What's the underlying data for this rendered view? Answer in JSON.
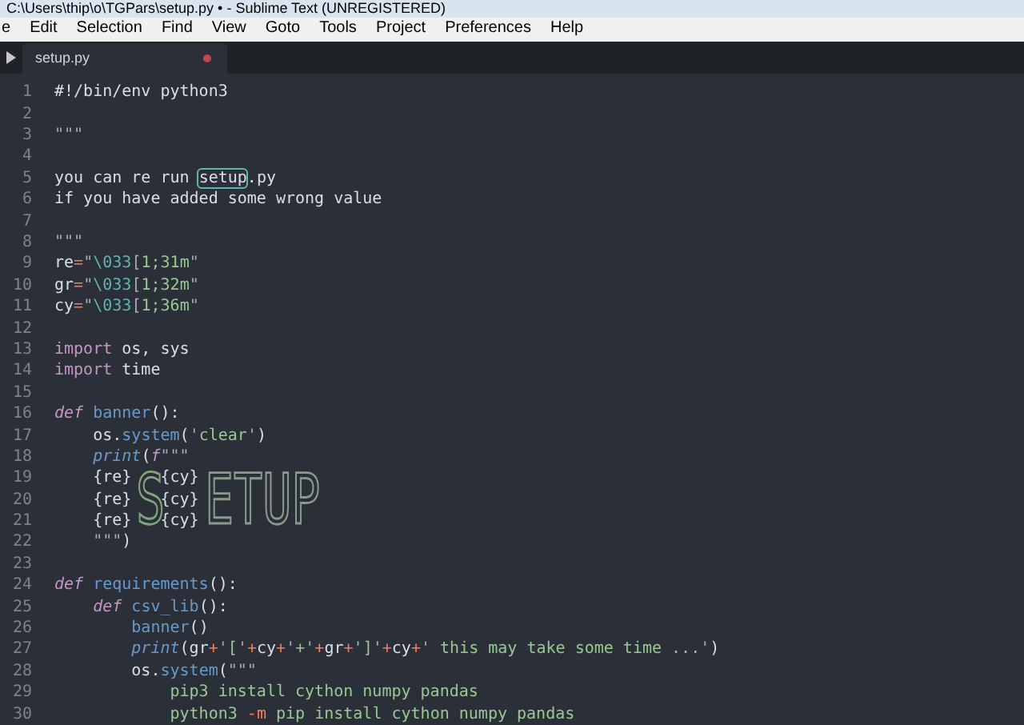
{
  "window": {
    "title": "C:\\Users\\thip\\o\\TGPars\\setup.py • - Sublime Text (UNREGISTERED)"
  },
  "menu": [
    "e",
    "Edit",
    "Selection",
    "Find",
    "View",
    "Goto",
    "Tools",
    "Project",
    "Preferences",
    "Help"
  ],
  "tabs": [
    {
      "label": "setup.py",
      "selected": true,
      "modified": true
    }
  ],
  "ascii_art": [
    "S",
    "ETUP"
  ],
  "lines": [
    {
      "n": "1",
      "tokens": [
        {
          "kind": "p",
          "text": "#!/bin/env python3"
        }
      ]
    },
    {
      "n": "2"
    },
    {
      "n": "3",
      "tokens": [
        {
          "kind": "q",
          "text": "\"\"\""
        }
      ]
    },
    {
      "n": "4"
    },
    {
      "n": "5",
      "tokens": [
        {
          "kind": "p",
          "text": "you can re run "
        },
        {
          "kind": "hl",
          "text": "setup"
        },
        {
          "kind": "p",
          "text": ".py"
        }
      ]
    },
    {
      "n": "6",
      "tokens": [
        {
          "kind": "p",
          "text": "if you have added some wrong value"
        }
      ]
    },
    {
      "n": "7"
    },
    {
      "n": "8",
      "tokens": [
        {
          "kind": "q",
          "text": "\"\"\""
        }
      ]
    },
    {
      "n": "9",
      "tokens": [
        {
          "kind": "p",
          "text": "re"
        },
        {
          "kind": "o",
          "text": "="
        },
        {
          "kind": "q",
          "text": "\""
        },
        {
          "kind": "e",
          "text": "\\033"
        },
        {
          "kind": "q",
          "text": "["
        },
        {
          "kind": "s",
          "text": "1;31m"
        },
        {
          "kind": "q",
          "text": "\""
        }
      ]
    },
    {
      "n": "10",
      "tokens": [
        {
          "kind": "p",
          "text": "gr"
        },
        {
          "kind": "o",
          "text": "="
        },
        {
          "kind": "q",
          "text": "\""
        },
        {
          "kind": "e",
          "text": "\\033"
        },
        {
          "kind": "q",
          "text": "["
        },
        {
          "kind": "s",
          "text": "1;32m"
        },
        {
          "kind": "q",
          "text": "\""
        }
      ]
    },
    {
      "n": "11",
      "tokens": [
        {
          "kind": "p",
          "text": "cy"
        },
        {
          "kind": "o",
          "text": "="
        },
        {
          "kind": "q",
          "text": "\""
        },
        {
          "kind": "e",
          "text": "\\033"
        },
        {
          "kind": "q",
          "text": "["
        },
        {
          "kind": "s",
          "text": "1;36m"
        },
        {
          "kind": "q",
          "text": "\""
        }
      ]
    },
    {
      "n": "12"
    },
    {
      "n": "13",
      "tokens": [
        {
          "kind": "k",
          "text": "import"
        },
        {
          "kind": "p",
          "text": " os, sys"
        }
      ]
    },
    {
      "n": "14",
      "tokens": [
        {
          "kind": "k",
          "text": "import"
        },
        {
          "kind": "p",
          "text": " time"
        }
      ]
    },
    {
      "n": "15"
    },
    {
      "n": "16",
      "tokens": [
        {
          "kind": "d",
          "text": "def"
        },
        {
          "kind": "f",
          "text": " banner"
        },
        {
          "kind": "p",
          "text": "():"
        }
      ]
    },
    {
      "n": "17",
      "tokens": [
        {
          "kind": "p",
          "text": "    os."
        },
        {
          "kind": "f",
          "text": "system"
        },
        {
          "kind": "p",
          "text": "("
        },
        {
          "kind": "q",
          "text": "'"
        },
        {
          "kind": "s",
          "text": "clear"
        },
        {
          "kind": "q",
          "text": "'"
        },
        {
          "kind": "p",
          "text": ")"
        }
      ]
    },
    {
      "n": "18",
      "tokens": [
        {
          "kind": "b",
          "text": "    print"
        },
        {
          "kind": "p",
          "text": "("
        },
        {
          "kind": "d",
          "text": "f"
        },
        {
          "kind": "q",
          "text": "\"\"\""
        }
      ]
    },
    {
      "n": "19",
      "tokens": [
        {
          "kind": "p",
          "text": "    {re}   {cy}"
        }
      ]
    },
    {
      "n": "20",
      "tokens": [
        {
          "kind": "p",
          "text": "    {re}   {cy}"
        }
      ]
    },
    {
      "n": "21",
      "tokens": [
        {
          "kind": "p",
          "text": "    {re}   {cy}"
        }
      ]
    },
    {
      "n": "22",
      "tokens": [
        {
          "kind": "q",
          "text": "    \"\"\""
        },
        {
          "kind": "p",
          "text": ")"
        }
      ]
    },
    {
      "n": "23"
    },
    {
      "n": "24",
      "tokens": [
        {
          "kind": "d",
          "text": "def"
        },
        {
          "kind": "f",
          "text": " requirements"
        },
        {
          "kind": "p",
          "text": "():"
        }
      ]
    },
    {
      "n": "25",
      "tokens": [
        {
          "kind": "d",
          "text": "    def"
        },
        {
          "kind": "f",
          "text": " csv_lib"
        },
        {
          "kind": "p",
          "text": "():"
        }
      ]
    },
    {
      "n": "26",
      "tokens": [
        {
          "kind": "f",
          "text": "        banner"
        },
        {
          "kind": "p",
          "text": "()"
        }
      ]
    },
    {
      "n": "27",
      "tokens": [
        {
          "kind": "b",
          "text": "        print"
        },
        {
          "kind": "p",
          "text": "(gr"
        },
        {
          "kind": "o",
          "text": "+"
        },
        {
          "kind": "q",
          "text": "'"
        },
        {
          "kind": "s",
          "text": "["
        },
        {
          "kind": "q",
          "text": "'"
        },
        {
          "kind": "o",
          "text": "+"
        },
        {
          "kind": "p",
          "text": "cy"
        },
        {
          "kind": "o",
          "text": "+"
        },
        {
          "kind": "q",
          "text": "'"
        },
        {
          "kind": "s",
          "text": "+"
        },
        {
          "kind": "q",
          "text": "'"
        },
        {
          "kind": "o",
          "text": "+"
        },
        {
          "kind": "p",
          "text": "gr"
        },
        {
          "kind": "o",
          "text": "+"
        },
        {
          "kind": "q",
          "text": "'"
        },
        {
          "kind": "s",
          "text": "]"
        },
        {
          "kind": "q",
          "text": "'"
        },
        {
          "kind": "o",
          "text": "+"
        },
        {
          "kind": "p",
          "text": "cy"
        },
        {
          "kind": "o",
          "text": "+"
        },
        {
          "kind": "q",
          "text": "'"
        },
        {
          "kind": "s",
          "text": " this may take some time ..."
        },
        {
          "kind": "q",
          "text": "'"
        },
        {
          "kind": "p",
          "text": ")"
        }
      ]
    },
    {
      "n": "28",
      "tokens": [
        {
          "kind": "p",
          "text": "        os."
        },
        {
          "kind": "f",
          "text": "system"
        },
        {
          "kind": "p",
          "text": "("
        },
        {
          "kind": "q",
          "text": "\"\"\""
        }
      ]
    },
    {
      "n": "29",
      "tokens": [
        {
          "kind": "s",
          "text": "            pip3 install cython numpy pandas"
        }
      ]
    },
    {
      "n": "30",
      "tokens": [
        {
          "kind": "s",
          "text": "            python3 "
        },
        {
          "kind": "o",
          "text": "-m"
        },
        {
          "kind": "s",
          "text": " pip install cython numpy pandas"
        }
      ]
    }
  ]
}
